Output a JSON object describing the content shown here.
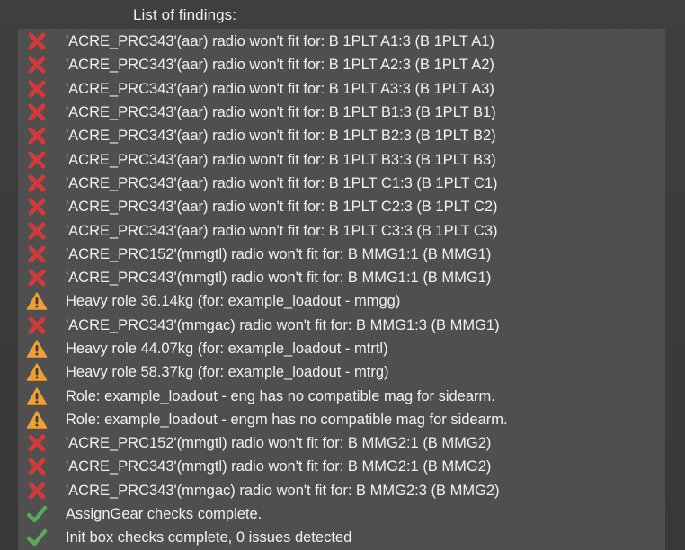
{
  "title": "List of findings:",
  "colors": {
    "error": "#d23a3a",
    "warning": "#f0a030",
    "success": "#5aa85a"
  },
  "findings": [
    {
      "type": "error",
      "icon": "x-icon",
      "text": "'ACRE_PRC343'(aar) radio won't fit for: B 1PLT A1:3 (B 1PLT A1)"
    },
    {
      "type": "error",
      "icon": "x-icon",
      "text": "'ACRE_PRC343'(aar) radio won't fit for: B 1PLT A2:3 (B 1PLT A2)"
    },
    {
      "type": "error",
      "icon": "x-icon",
      "text": "'ACRE_PRC343'(aar) radio won't fit for: B 1PLT A3:3 (B 1PLT A3)"
    },
    {
      "type": "error",
      "icon": "x-icon",
      "text": "'ACRE_PRC343'(aar) radio won't fit for: B 1PLT B1:3 (B 1PLT B1)"
    },
    {
      "type": "error",
      "icon": "x-icon",
      "text": "'ACRE_PRC343'(aar) radio won't fit for: B 1PLT B2:3 (B 1PLT B2)"
    },
    {
      "type": "error",
      "icon": "x-icon",
      "text": "'ACRE_PRC343'(aar) radio won't fit for: B 1PLT B3:3 (B 1PLT B3)"
    },
    {
      "type": "error",
      "icon": "x-icon",
      "text": "'ACRE_PRC343'(aar) radio won't fit for: B 1PLT C1:3 (B 1PLT C1)"
    },
    {
      "type": "error",
      "icon": "x-icon",
      "text": "'ACRE_PRC343'(aar) radio won't fit for: B 1PLT C2:3 (B 1PLT C2)"
    },
    {
      "type": "error",
      "icon": "x-icon",
      "text": "'ACRE_PRC343'(aar) radio won't fit for: B 1PLT C3:3 (B 1PLT C3)"
    },
    {
      "type": "error",
      "icon": "x-icon",
      "text": "'ACRE_PRC152'(mmgtl) radio won't fit for: B MMG1:1 (B MMG1)"
    },
    {
      "type": "error",
      "icon": "x-icon",
      "text": "'ACRE_PRC343'(mmgtl) radio won't fit for: B MMG1:1 (B MMG1)"
    },
    {
      "type": "warning",
      "icon": "warning-icon",
      "text": "Heavy role 36.14kg (for: example_loadout - mmgg)"
    },
    {
      "type": "error",
      "icon": "x-icon",
      "text": "'ACRE_PRC343'(mmgac) radio won't fit for: B MMG1:3 (B MMG1)"
    },
    {
      "type": "warning",
      "icon": "warning-icon",
      "text": "Heavy role 44.07kg (for: example_loadout - mtrtl)"
    },
    {
      "type": "warning",
      "icon": "warning-icon",
      "text": "Heavy role 58.37kg (for: example_loadout - mtrg)"
    },
    {
      "type": "warning",
      "icon": "warning-icon",
      "text": "Role: example_loadout - eng has no compatible mag for sidearm."
    },
    {
      "type": "warning",
      "icon": "warning-icon",
      "text": "Role: example_loadout - engm has no compatible mag for sidearm."
    },
    {
      "type": "error",
      "icon": "x-icon",
      "text": "'ACRE_PRC152'(mmgtl) radio won't fit for: B MMG2:1 (B MMG2)"
    },
    {
      "type": "error",
      "icon": "x-icon",
      "text": "'ACRE_PRC343'(mmgtl) radio won't fit for: B MMG2:1 (B MMG2)"
    },
    {
      "type": "error",
      "icon": "x-icon",
      "text": "'ACRE_PRC343'(mmgac) radio won't fit for: B MMG2:3 (B MMG2)"
    },
    {
      "type": "success",
      "icon": "checkmark-icon",
      "text": "AssignGear checks complete."
    },
    {
      "type": "success",
      "icon": "checkmark-icon",
      "text": "Init box checks complete, 0 issues detected"
    }
  ]
}
